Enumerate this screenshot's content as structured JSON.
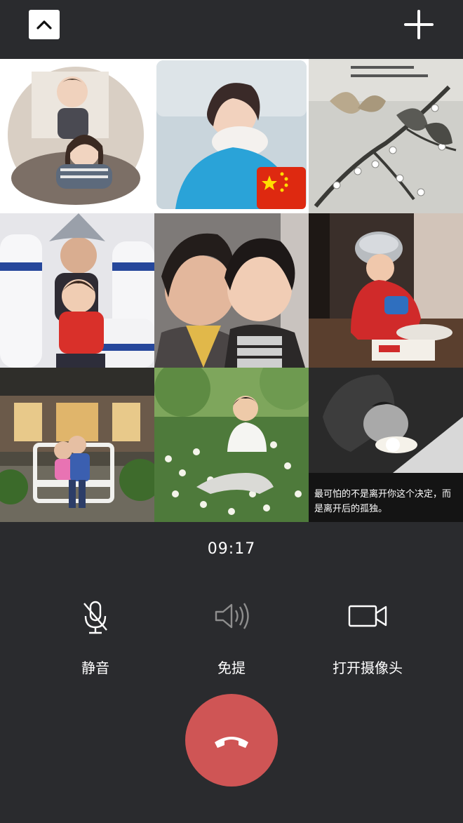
{
  "call": {
    "timer": "09:17",
    "controls": {
      "mute_label": "静音",
      "speaker_label": "免提",
      "camera_label": "打开摄像头"
    }
  },
  "participants": [
    {
      "name": "participant-1"
    },
    {
      "name": "participant-2"
    },
    {
      "name": "participant-3"
    },
    {
      "name": "participant-4"
    },
    {
      "name": "participant-5"
    },
    {
      "name": "participant-6"
    },
    {
      "name": "participant-7"
    },
    {
      "name": "participant-8"
    },
    {
      "name": "participant-9",
      "caption": "最可怕的不是离开你这个决定，而是离开后的孤独。"
    }
  ],
  "icons": {
    "collapse": "chevron-up-icon",
    "add": "plus-icon",
    "mute": "microphone-off-icon",
    "speaker": "speaker-icon",
    "camera": "video-camera-icon",
    "hangup": "phone-hangup-icon"
  },
  "colors": {
    "background": "#2a2b2e",
    "hangup": "#cf5555",
    "text": "#ffffff"
  }
}
